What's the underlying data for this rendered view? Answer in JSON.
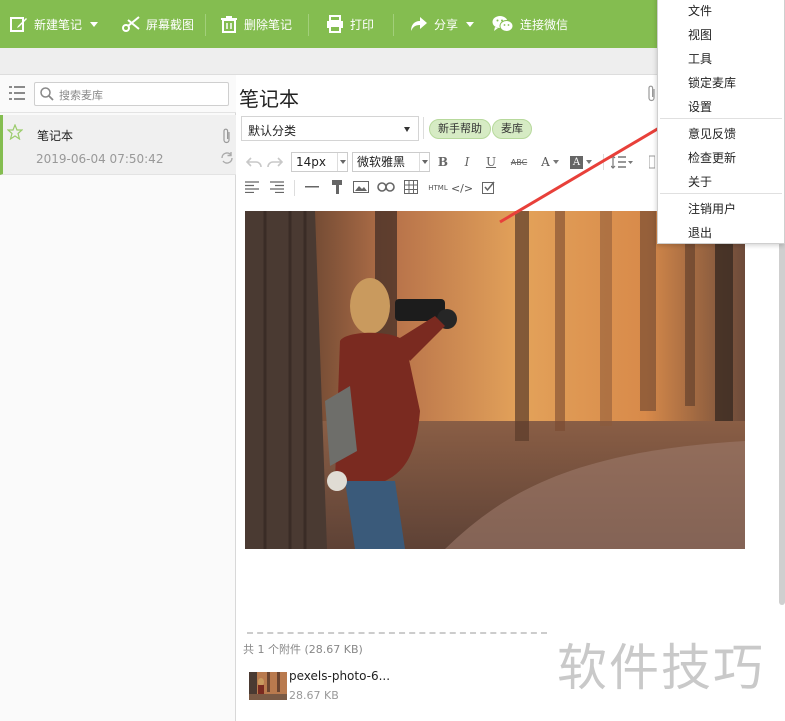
{
  "toolbar": {
    "new_note": "新建笔记",
    "screenshot": "屏幕截图",
    "delete_note": "删除笔记",
    "print": "打印",
    "share": "分享",
    "connect_wechat": "连接微信"
  },
  "sidebar": {
    "search_placeholder": "搜索麦库",
    "notes": [
      {
        "title": "笔记本",
        "date": "2019-06-04 07:50:42"
      }
    ]
  },
  "editor": {
    "title": "笔记本",
    "category": "默认分类",
    "tags": [
      "新手帮助",
      "麦库"
    ],
    "font_size": "14px",
    "font_family": "微软雅黑",
    "buttons": {
      "bold": "B",
      "italic": "I",
      "underline": "U",
      "strike": "ABC",
      "html": "HTML",
      "code": "</>"
    }
  },
  "attachments": {
    "count_label": "共 1 个附件 (28.67 KB)",
    "items": [
      {
        "name": "pexels-photo-6...",
        "size": "28.67 KB"
      }
    ]
  },
  "menu": {
    "items": [
      "文件",
      "视图",
      "工具",
      "锁定麦库",
      "设置",
      "意见反馈",
      "检查更新",
      "关于",
      "注销用户",
      "退出"
    ]
  },
  "watermark": "软件技巧",
  "colors": {
    "toolbar_green": "#84bd50",
    "tag_bg": "#d6ebc4",
    "arrow_red": "#e8403a"
  }
}
